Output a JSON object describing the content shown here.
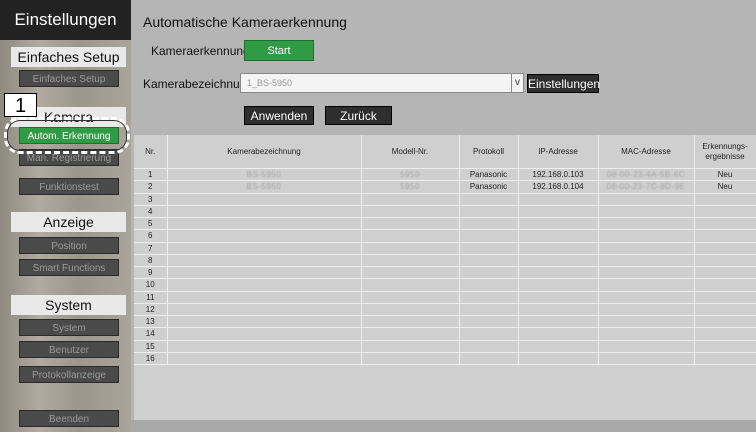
{
  "sidebar": {
    "title": "Einstellungen",
    "sections": {
      "setup": "Einfaches Setup",
      "camera": "Kamera",
      "display": "Anzeige",
      "system": "System"
    },
    "buttons": {
      "easy_setup": "Einfaches Setup",
      "auto_detect": "Autom. Erkennung",
      "manual_reg": "Man. Registrierung",
      "function_test": "Funktionstest",
      "position": "Position",
      "smart_functions": "Smart Functions",
      "system": "System",
      "users": "Benutzer",
      "log": "Protokollanzeige",
      "exit": "Beenden"
    },
    "marker": "1"
  },
  "main": {
    "title": "Automatische Kameraerkennung",
    "detect_label": "Kameraerkennung",
    "start_label": "Start",
    "name_label": "Kamerabezeichnung",
    "dropdown_value": "1_BS-5950",
    "settings_label": "Einstellungen",
    "apply_label": "Anwenden",
    "back_label": "Zurück"
  },
  "table": {
    "headers": [
      "Nr.",
      "Kamerabezeichnung",
      "Modell-Nr.",
      "Protokoll",
      "IP-Adresse",
      "MAC-Adresse",
      "Erkennungs-ergebnisse"
    ],
    "rows": [
      [
        "1",
        "BS-5950",
        "5950",
        "Panasonic",
        "192.168.0.103",
        "08-00-23-4A-5B-6C",
        "Neu"
      ],
      [
        "2",
        "BS-5950",
        "5950",
        "Panasonic",
        "192.168.0.104",
        "08-00-23-7C-8D-9E",
        "Neu"
      ],
      [
        "3",
        "",
        "",
        "",
        "",
        "",
        ""
      ],
      [
        "4",
        "",
        "",
        "",
        "",
        "",
        ""
      ],
      [
        "5",
        "",
        "",
        "",
        "",
        "",
        ""
      ],
      [
        "6",
        "",
        "",
        "",
        "",
        "",
        ""
      ],
      [
        "7",
        "",
        "",
        "",
        "",
        "",
        ""
      ],
      [
        "8",
        "",
        "",
        "",
        "",
        "",
        ""
      ],
      [
        "9",
        "",
        "",
        "",
        "",
        "",
        ""
      ],
      [
        "10",
        "",
        "",
        "",
        "",
        "",
        ""
      ],
      [
        "11",
        "",
        "",
        "",
        "",
        "",
        ""
      ],
      [
        "12",
        "",
        "",
        "",
        "",
        "",
        ""
      ],
      [
        "13",
        "",
        "",
        "",
        "",
        "",
        ""
      ],
      [
        "14",
        "",
        "",
        "",
        "",
        "",
        ""
      ],
      [
        "15",
        "",
        "",
        "",
        "",
        "",
        ""
      ],
      [
        "16",
        "",
        "",
        "",
        "",
        "",
        ""
      ]
    ]
  },
  "colors": {
    "accent_green": "#2f9b45",
    "sidebar_title_bg": "#222222",
    "main_bg": "#b5b5b5"
  }
}
